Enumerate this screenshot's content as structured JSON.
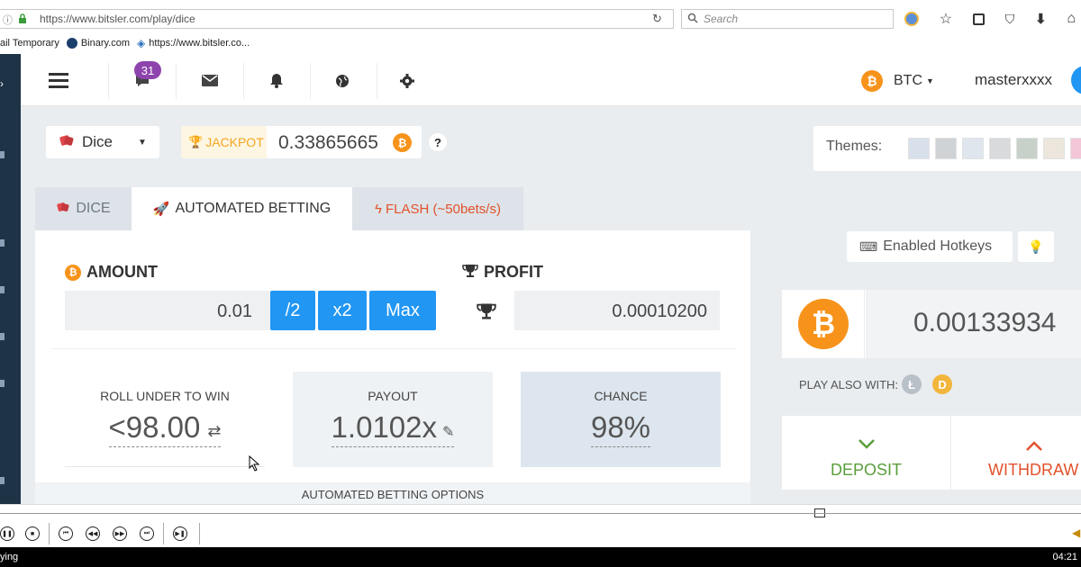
{
  "browser": {
    "url": "https://www.bitsler.com/play/dice",
    "search_placeholder": "Search",
    "bookmarks": [
      {
        "label": "ail Temporary"
      },
      {
        "label": "Binary.com"
      },
      {
        "label": "https://www.bitsler.co..."
      }
    ]
  },
  "header": {
    "chat_badge": "31",
    "currency": "BTC",
    "username": "masterxxxx"
  },
  "game_select": {
    "label": "Dice"
  },
  "jackpot": {
    "label": "JACKPOT",
    "value": "0.33865665",
    "help": "?"
  },
  "themes": {
    "label": "Themes:",
    "swatches": [
      "#d8e0ec",
      "#cfd3d6",
      "#dfe6ee",
      "#d8dadc",
      "#c7d1c9",
      "#ece6dc",
      "#f2c6d6"
    ]
  },
  "tabs": [
    {
      "label": "DICE"
    },
    {
      "label": "AUTOMATED BETTING"
    },
    {
      "label": "FLASH (~50bets/s)"
    }
  ],
  "amount": {
    "label": "AMOUNT",
    "value": "0.01",
    "half": "/2",
    "double": "x2",
    "max": "Max"
  },
  "profit": {
    "label": "PROFIT",
    "value": "0.00010200"
  },
  "stats": {
    "roll_label": "ROLL UNDER TO WIN",
    "roll_value": "<98.00",
    "payout_label": "PAYOUT",
    "payout_value": "1.0102x",
    "chance_label": "CHANCE",
    "chance_value": "98%"
  },
  "footer_label": "AUTOMATED BETTING OPTIONS",
  "hotkeys": {
    "label": "Enabled Hotkeys"
  },
  "balance": {
    "value": "0.00133934"
  },
  "play_also": {
    "label": "PLAY ALSO WITH:"
  },
  "deposit": {
    "label": "DEPOSIT"
  },
  "withdraw": {
    "label": "WITHDRAW"
  },
  "player": {
    "status": "ying",
    "time": "04:21"
  },
  "colors": {
    "accent": "#2196f3",
    "btc": "#f7931a",
    "deposit": "#5a9e3b",
    "withdraw": "#e2512c",
    "flash": "#e2512c",
    "sidebar": "#1f3346"
  }
}
